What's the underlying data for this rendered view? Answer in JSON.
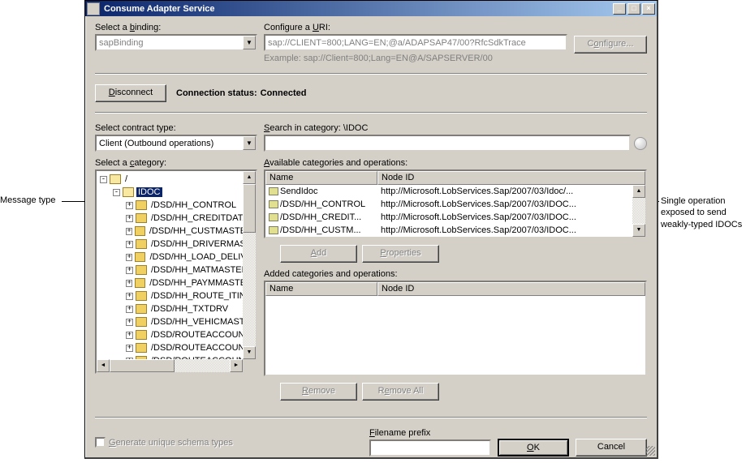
{
  "window_title": "Consume Adapter Service",
  "annotations": {
    "left": "Message type",
    "right": "Single operation exposed to send weakly-typed IDOCs"
  },
  "binding": {
    "label": "Select a binding:",
    "underline": "b",
    "value": "sapBinding"
  },
  "uri": {
    "label": "Configure a URI:",
    "underline": "U",
    "value": "sap://CLIENT=800;LANG=EN;@a/ADAPSAP47/00?RfcSdkTrace",
    "example": "Example: sap://Client=800;Lang=EN@A/SAPSERVER/00"
  },
  "buttons": {
    "configure": "Configure...",
    "disconnect": "Disconnect",
    "add": "Add",
    "properties": "Properties",
    "remove": "Remove",
    "remove_all": "Remove All",
    "ok": "OK",
    "cancel": "Cancel"
  },
  "status": {
    "label": "Connection status:",
    "value": "Connected"
  },
  "contract": {
    "label": "Select contract type:",
    "value": "Client (Outbound operations)"
  },
  "search": {
    "label": "Search in category: \\IDOC",
    "underline": "S"
  },
  "category": {
    "label": "Select a category:",
    "underline": "c"
  },
  "tree": {
    "root": "/",
    "selected": "IDOC",
    "items": [
      "/DSD/HH_CONTROL",
      "/DSD/HH_CREDITDATA",
      "/DSD/HH_CUSTMASTER",
      "/DSD/HH_DRIVERMAST",
      "/DSD/HH_LOAD_DELIVE",
      "/DSD/HH_MATMASTER",
      "/DSD/HH_PAYMMASTER",
      "/DSD/HH_ROUTE_ITINE",
      "/DSD/HH_TXTDRV",
      "/DSD/HH_VEHICMAST",
      "/DSD/ROUTEACCOUNT",
      "/DSD/ROUTEACCOUNT",
      "/DSD/ROUTEACCOUNT"
    ]
  },
  "available": {
    "label": "Available categories and operations:",
    "underline": "A",
    "col_name": "Name",
    "col_nodeid": "Node ID",
    "rows": [
      {
        "name": "SendIdoc",
        "nodeid": "http://Microsoft.LobServices.Sap/2007/03/Idoc/..."
      },
      {
        "name": "/DSD/HH_CONTROL",
        "nodeid": "http://Microsoft.LobServices.Sap/2007/03/IDOC..."
      },
      {
        "name": "/DSD/HH_CREDIT...",
        "nodeid": "http://Microsoft.LobServices.Sap/2007/03/IDOC..."
      },
      {
        "name": "/DSD/HH_CUSTM...",
        "nodeid": "http://Microsoft.LobServices.Sap/2007/03/IDOC..."
      }
    ]
  },
  "added": {
    "label": "Added categories and operations:",
    "col_name": "Name",
    "col_nodeid": "Node ID"
  },
  "schema": {
    "label": "Generate unique schema types",
    "underline": "G"
  },
  "filename": {
    "label": "Filename prefix",
    "underline": "F"
  },
  "underlines": {
    "disconnect": "D",
    "add": "A",
    "properties": "P",
    "remove": "R",
    "remove_all": "e",
    "ok": "O"
  }
}
